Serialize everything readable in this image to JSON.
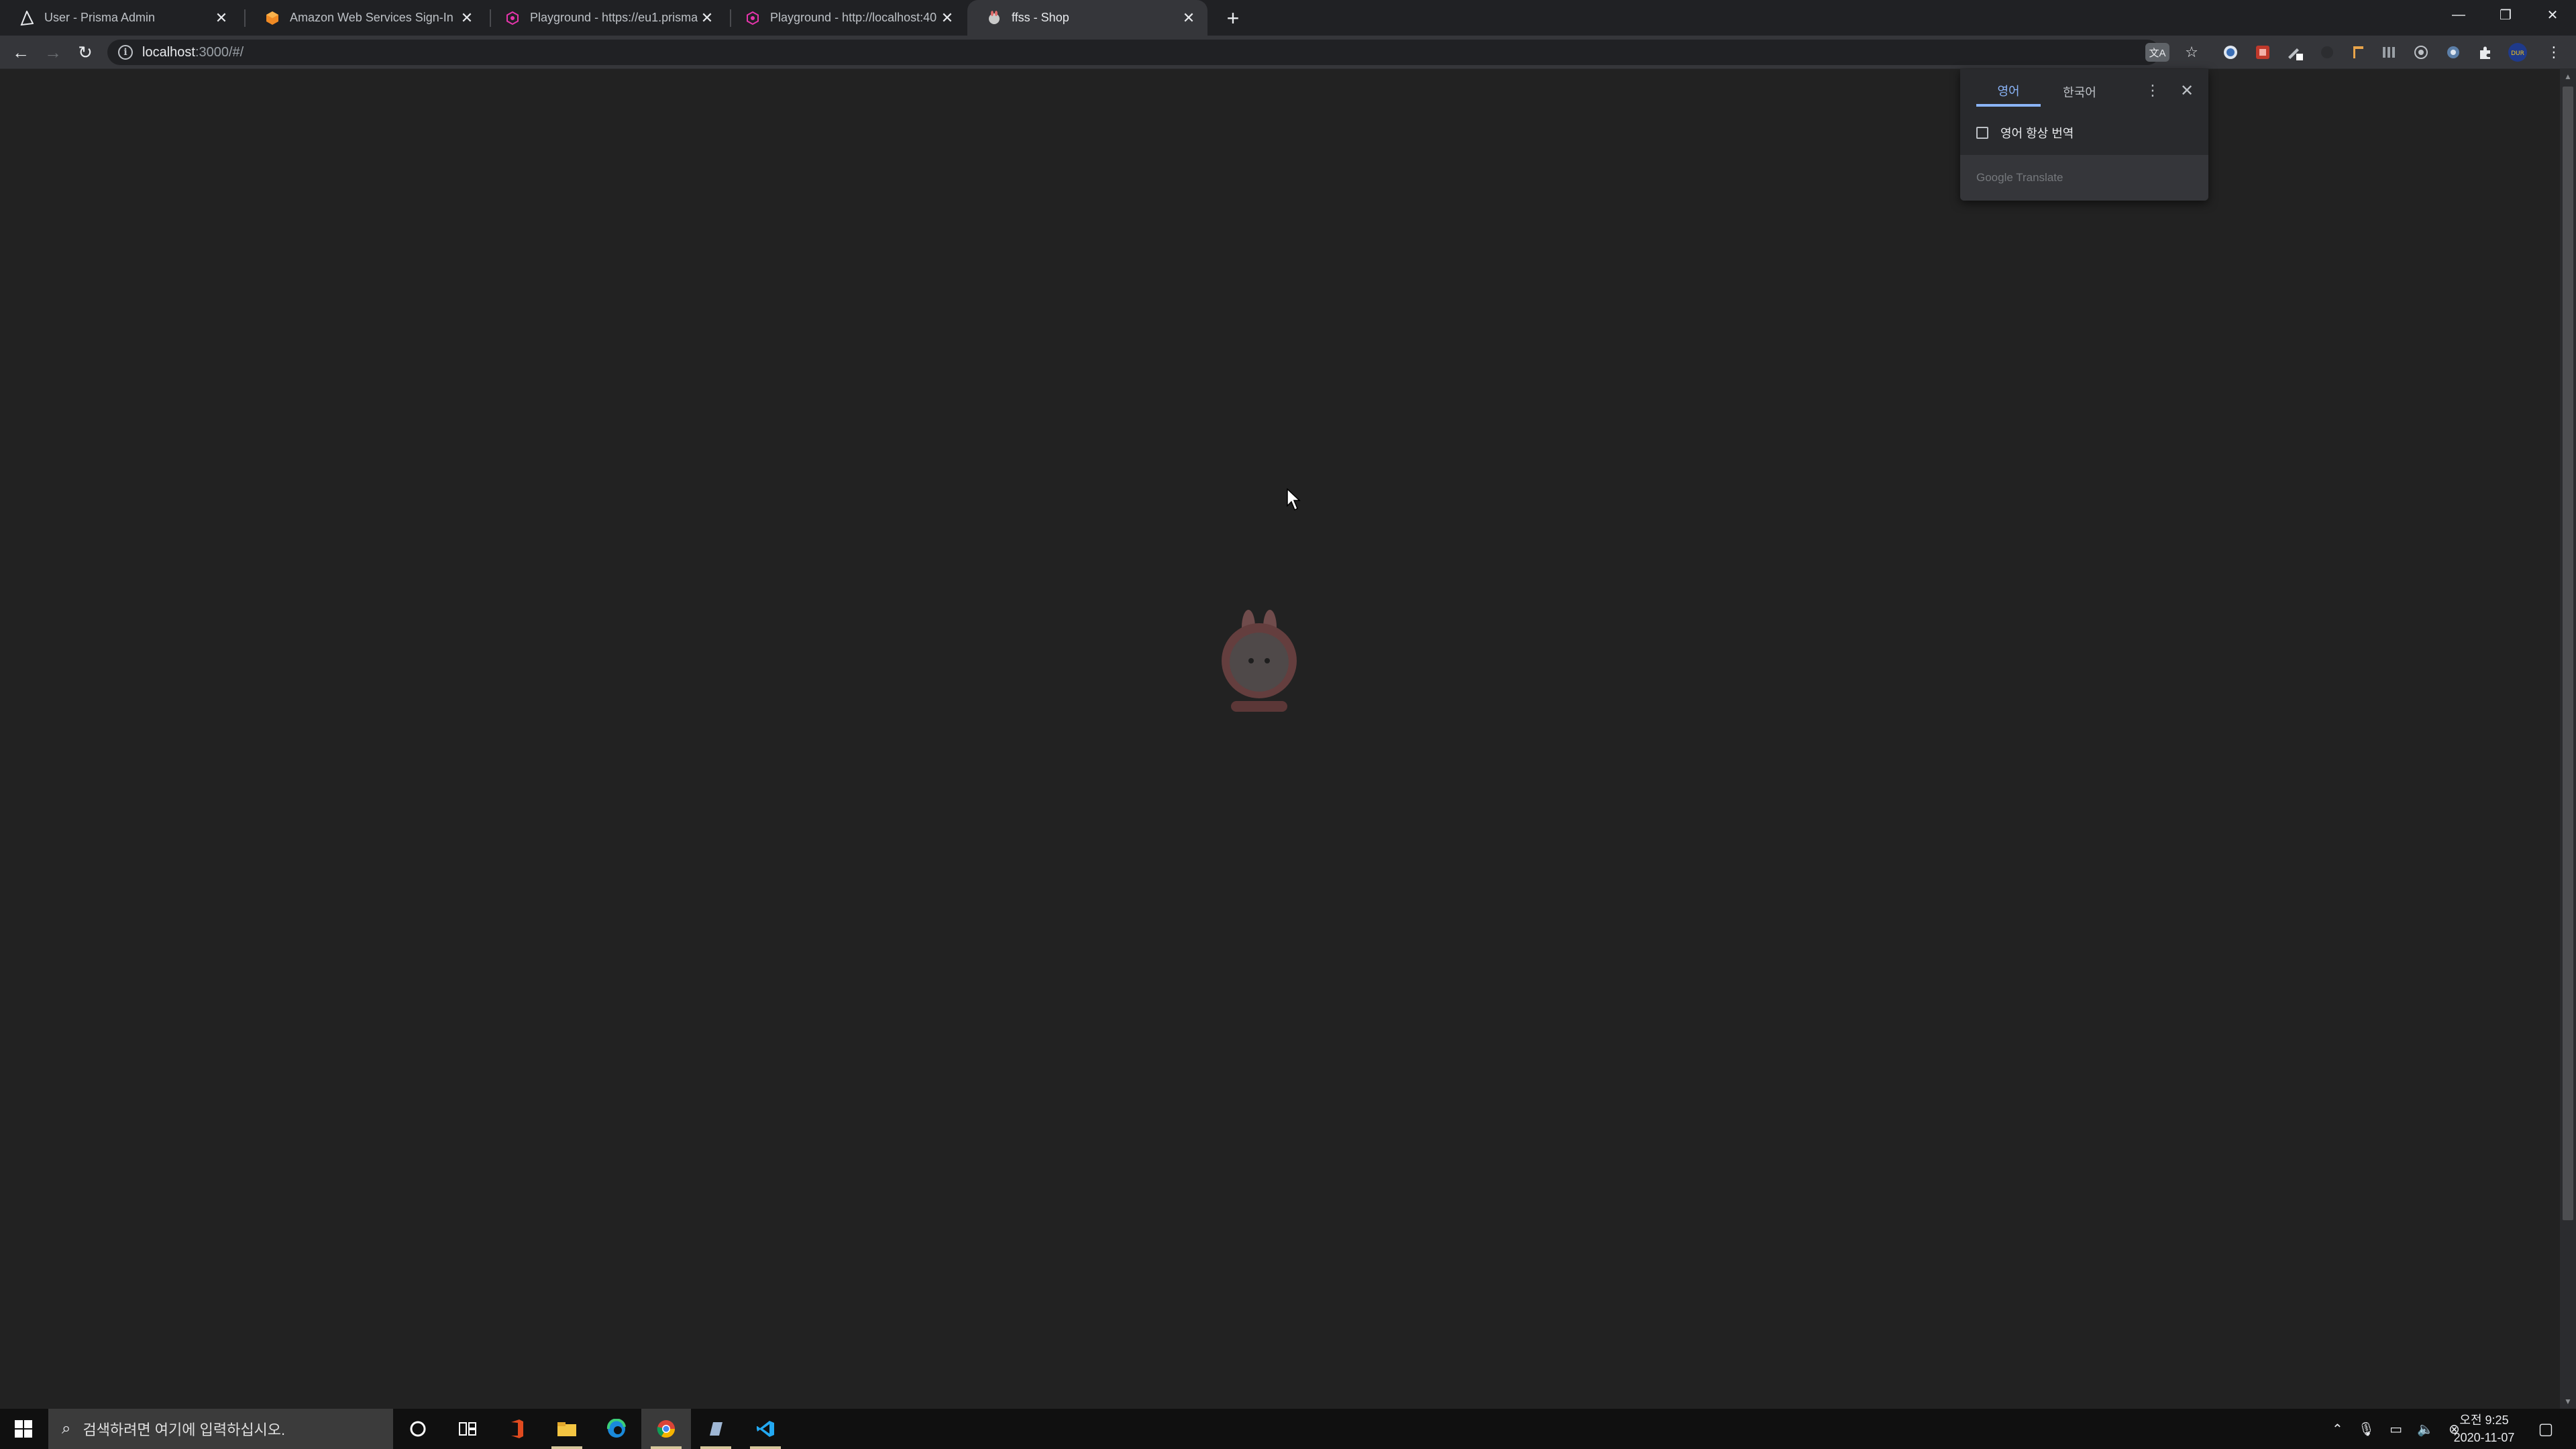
{
  "browser": {
    "tabs": [
      {
        "title": "User - Prisma Admin",
        "favicon": "prisma-icon"
      },
      {
        "title": "Amazon Web Services Sign-In",
        "favicon": "aws-icon"
      },
      {
        "title": "Playground - https://eu1.prisma",
        "favicon": "graphql-icon"
      },
      {
        "title": "Playground - http://localhost:40",
        "favicon": "graphql-icon"
      },
      {
        "title": "ffss - Shop",
        "favicon": "shop-icon",
        "active": true
      }
    ],
    "new_tab": "+",
    "window_controls": {
      "minimize": "—",
      "restore": "❐",
      "close": "✕"
    }
  },
  "toolbar": {
    "back": "←",
    "forward": "→",
    "reload": "↻",
    "url_host": "localhost",
    "url_path": ":3000/#/",
    "translate_icon_label": "文A",
    "bookmark_star": "☆",
    "menu": "⋮"
  },
  "translate_popup": {
    "tabs": [
      "영어",
      "한국어"
    ],
    "selected_tab": "영어",
    "always_translate_label": "영어 항상 번역",
    "always_translate_checked": false,
    "footer": "Google Translate",
    "more": "⋮",
    "close": "✕"
  },
  "page": {
    "state": "loading",
    "mascot": "rabbit-mascot-icon"
  },
  "taskbar": {
    "search_placeholder": "검색하려면 여기에 입력하십시오.",
    "clock_time": "오전 9:25",
    "clock_date": "2020-11-07"
  },
  "colors": {
    "page_bg": "#222222",
    "tabstrip_bg": "#202124",
    "toolbar_bg": "#35363a",
    "accent_blue": "#8ab4f8",
    "taskbar_bg": "#101010"
  }
}
